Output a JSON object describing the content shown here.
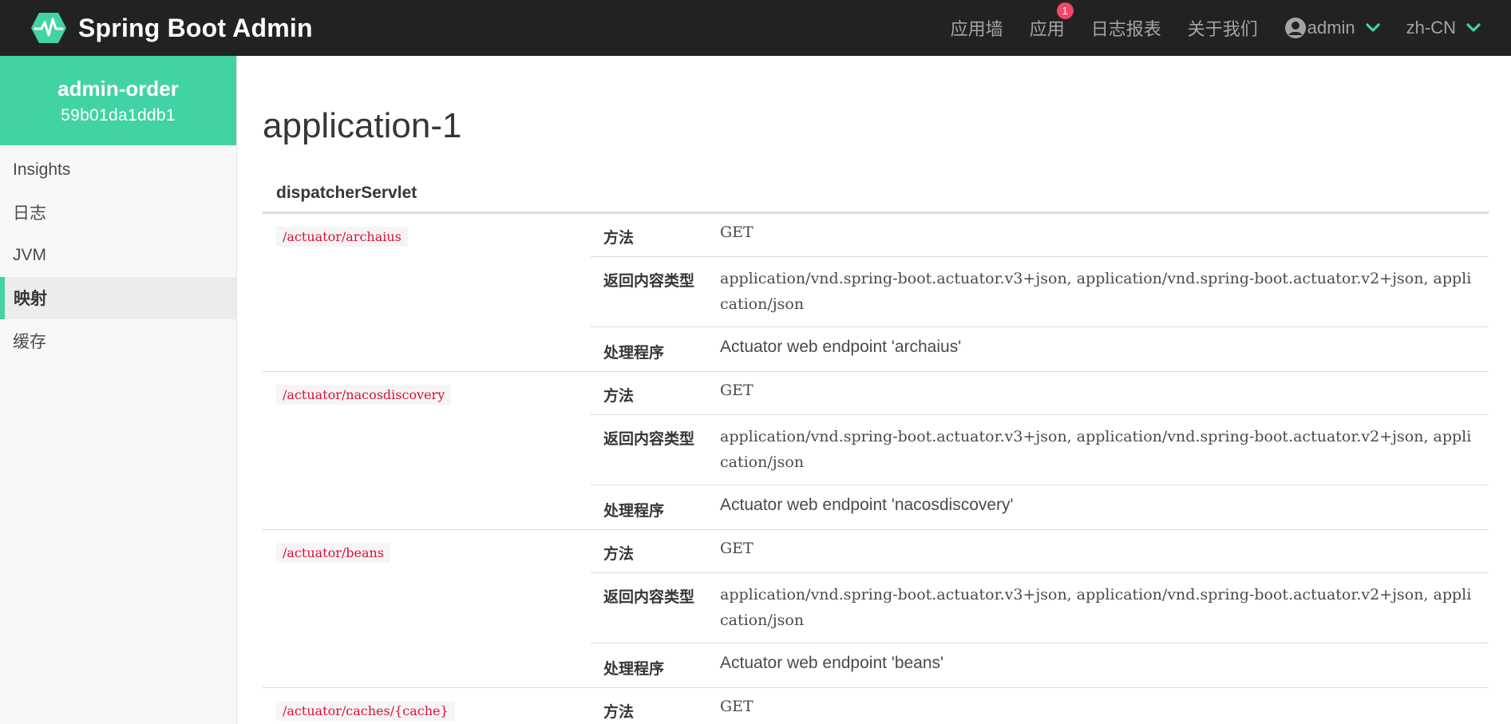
{
  "colors": {
    "navbar_bg": "#222222",
    "accent": "#42d3a5",
    "badge": "#f14668",
    "pattern_text": "#da1039"
  },
  "navbar": {
    "brand_title": "Spring Boot Admin",
    "logo_icon": "heartbeat-hexagon-icon",
    "items": [
      {
        "label": "应用墙"
      },
      {
        "label": "应用",
        "badge": "1"
      },
      {
        "label": "日志报表"
      },
      {
        "label": "关于我们"
      }
    ],
    "user": {
      "label": "admin",
      "icon": "user-circle-icon"
    },
    "language": {
      "label": "zh-CN"
    }
  },
  "sidebar": {
    "app_name": "admin-order",
    "app_id": "59b01da1ddb1",
    "items": [
      {
        "label": "Insights"
      },
      {
        "label": "日志"
      },
      {
        "label": "JVM"
      },
      {
        "label": "映射",
        "active": true
      },
      {
        "label": "缓存"
      }
    ]
  },
  "main": {
    "title": "application-1",
    "section_title": "dispatcherServlet",
    "labels": {
      "method": "方法",
      "produces": "返回内容类型",
      "handler": "处理程序"
    },
    "mappings": [
      {
        "pattern": "/actuator/archaius",
        "method": "GET",
        "produces": "application/vnd.spring-boot.actuator.v3+json, application/vnd.spring-boot.actuator.v2+json, application/json",
        "handler": "Actuator web endpoint 'archaius'"
      },
      {
        "pattern": "/actuator/nacosdiscovery",
        "method": "GET",
        "produces": "application/vnd.spring-boot.actuator.v3+json, application/vnd.spring-boot.actuator.v2+json, application/json",
        "handler": "Actuator web endpoint 'nacosdiscovery'"
      },
      {
        "pattern": "/actuator/beans",
        "method": "GET",
        "produces": "application/vnd.spring-boot.actuator.v3+json, application/vnd.spring-boot.actuator.v2+json, application/json",
        "handler": "Actuator web endpoint 'beans'"
      },
      {
        "pattern": "/actuator/caches/{cache}",
        "method": "GET"
      }
    ]
  }
}
